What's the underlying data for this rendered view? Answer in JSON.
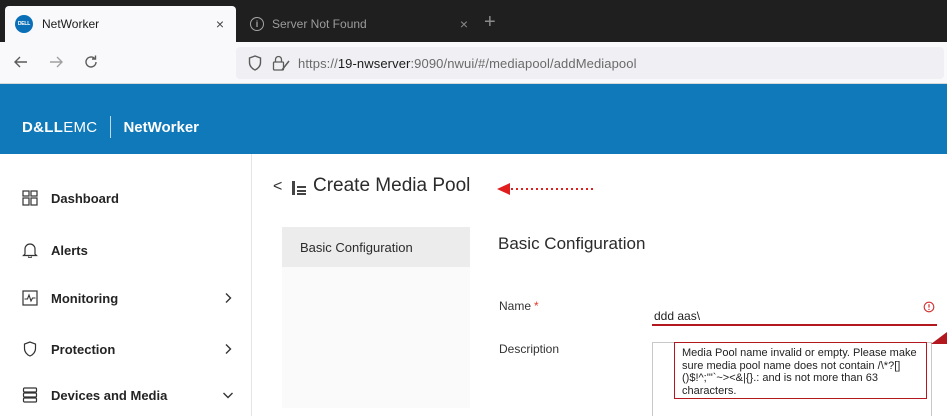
{
  "browser": {
    "tabs": [
      {
        "title": "NetWorker",
        "favicon_text": "DELL",
        "active": true
      },
      {
        "title": "Server Not Found",
        "active": false
      }
    ],
    "close_glyph": "×",
    "new_tab_glyph": "+",
    "url": {
      "scheme": "https://",
      "host": "19-nwserver",
      "rest": ":9090/nwui/#/mediapool/addMediapool"
    }
  },
  "app": {
    "brand_bold": "D&LL",
    "brand_light": "EMC",
    "product": "NetWorker",
    "accent_color": "#0f79b9"
  },
  "sidebar": {
    "items": [
      {
        "label": "Dashboard",
        "icon": "dashboard-icon",
        "chevron": ""
      },
      {
        "label": "Alerts",
        "icon": "bell-icon",
        "chevron": ""
      },
      {
        "label": "Monitoring",
        "icon": "monitoring-icon",
        "chevron": "right"
      },
      {
        "label": "Protection",
        "icon": "shield-icon",
        "chevron": "right"
      },
      {
        "label": "Devices and Media",
        "icon": "storage-icon",
        "chevron": "down"
      }
    ]
  },
  "main": {
    "back_glyph": "<",
    "page_title": "Create Media Pool",
    "subnav": [
      {
        "label": "Basic Configuration",
        "selected": true
      }
    ],
    "section_title": "Basic Configuration",
    "form": {
      "name_label": "Name",
      "required_mark": "*",
      "name_value": "ddd aas\\",
      "description_label": "Description",
      "error_message": "Media Pool name invalid or empty. Please make sure media pool name does not contain /\\*?[]()$!^;'\"`~><&|{}.: and is not more than 63 characters.",
      "error_color": "#b3181f"
    }
  }
}
